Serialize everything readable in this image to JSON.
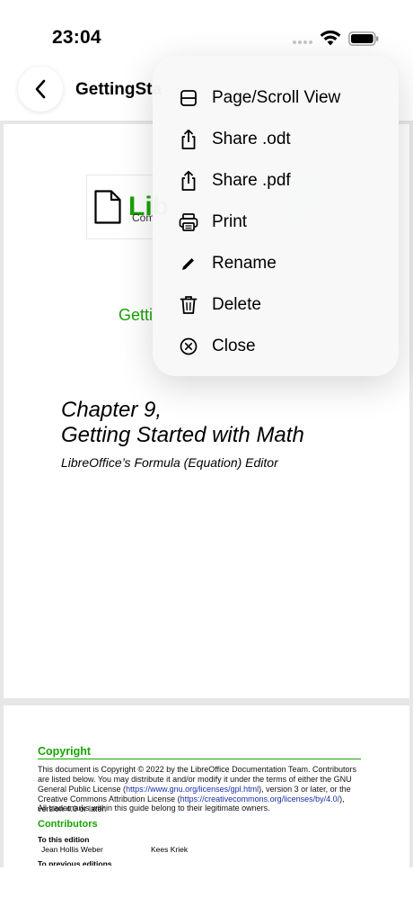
{
  "status_bar": {
    "time": "23:04"
  },
  "navbar": {
    "title": "GettingSta"
  },
  "menu": {
    "items": [
      {
        "label": "Page/Scroll View",
        "icon": "page-scroll-icon"
      },
      {
        "label": "Share .odt",
        "icon": "share-icon"
      },
      {
        "label": "Share .pdf",
        "icon": "share-icon"
      },
      {
        "label": "Print",
        "icon": "printer-icon"
      },
      {
        "label": "Rename",
        "icon": "pencil-icon"
      },
      {
        "label": "Delete",
        "icon": "trash-icon"
      },
      {
        "label": "Close",
        "icon": "close-circle-icon"
      }
    ]
  },
  "document": {
    "page1": {
      "logo_word": "Lib",
      "logo_sub": "Com",
      "heading_partial": "Getti",
      "chapter_line1": "Chapter 9,",
      "chapter_line2": "Getting Started with Math",
      "subtitle": "LibreOffice’s Formula (Equation) Editor"
    },
    "page2": {
      "copyright_heading": "Copyright",
      "copyright_text_1": "This document is Copyright © 2022 by the LibreOffice Documentation Team. Contributors are listed below. You may distribute it and/or modify it under the terms of either the GNU General Public License (",
      "gpl_link": "https://www.gnu.org/licenses/gpl.html",
      "copyright_text_2": "), version 3 or later, or the Creative Commons Attribution License (",
      "cc_link": "https://creativecommons.org/licenses/by/4.0/",
      "copyright_text_3": "), version 4.0 or later.",
      "trademarks": "All trademarks within this guide belong to their legitimate owners.",
      "contributors_heading": "Contributors",
      "this_edition_label": "To this edition",
      "contributor_1": "Jean Hollis Weber",
      "contributor_2": "Kees Kriek",
      "previous_editions_label": "To previous editions"
    }
  },
  "colors": {
    "accent_green": "#18a303",
    "link_blue": "#1a2fa8"
  }
}
